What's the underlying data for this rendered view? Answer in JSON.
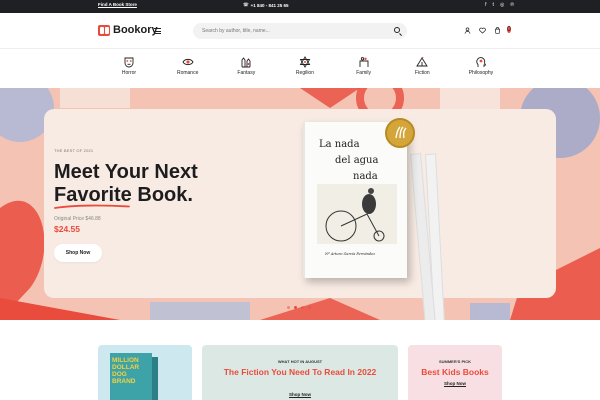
{
  "topbar": {
    "store_label": "Find A Book Store",
    "phone": "+1 840 - 841 25 65"
  },
  "brand": {
    "name": "Bookory",
    "accent": "#e94b3c"
  },
  "search": {
    "placeholder": "Search by author, title, name..."
  },
  "header_icons": [
    "user-icon",
    "heart-icon",
    "cart-icon"
  ],
  "cart": {
    "count": "0"
  },
  "categories": [
    {
      "label": "Horror",
      "icon": "mask-icon"
    },
    {
      "label": "Romance",
      "icon": "eye-icon"
    },
    {
      "label": "Fantasy",
      "icon": "castle-icon"
    },
    {
      "label": "Regilion",
      "icon": "star-of-david-icon"
    },
    {
      "label": "Family",
      "icon": "family-icon"
    },
    {
      "label": "Fiction",
      "icon": "tent-icon"
    },
    {
      "label": "Philosophy",
      "icon": "head-icon"
    }
  ],
  "hero": {
    "kicker": "THE BEST OF 2021",
    "headline_line1": "Meet Your Next",
    "headline_word": "Favorite",
    "headline_rest": "Book.",
    "original_price": "Original Price $46.88",
    "price": "$24.55",
    "button": "Shop Now",
    "book": {
      "title_1": "La nada",
      "title_2": "del agua",
      "title_3": "nada",
      "author": "Nº Arturo García Fernández"
    },
    "slides": 4,
    "active_slide": 1
  },
  "promos": [
    {
      "kicker": "",
      "title": "",
      "button": ""
    },
    {
      "kicker": "WHAT HOT IN AUGUST",
      "title": "The Fiction You Need To Read In 2022",
      "button": "Shop Now"
    },
    {
      "kicker": "SUMMER'S PICK",
      "title": "Best Kids Books",
      "button": "Shop Now"
    }
  ],
  "promo_book": {
    "text": "MILLION DOLLAR DOG BRAND"
  }
}
